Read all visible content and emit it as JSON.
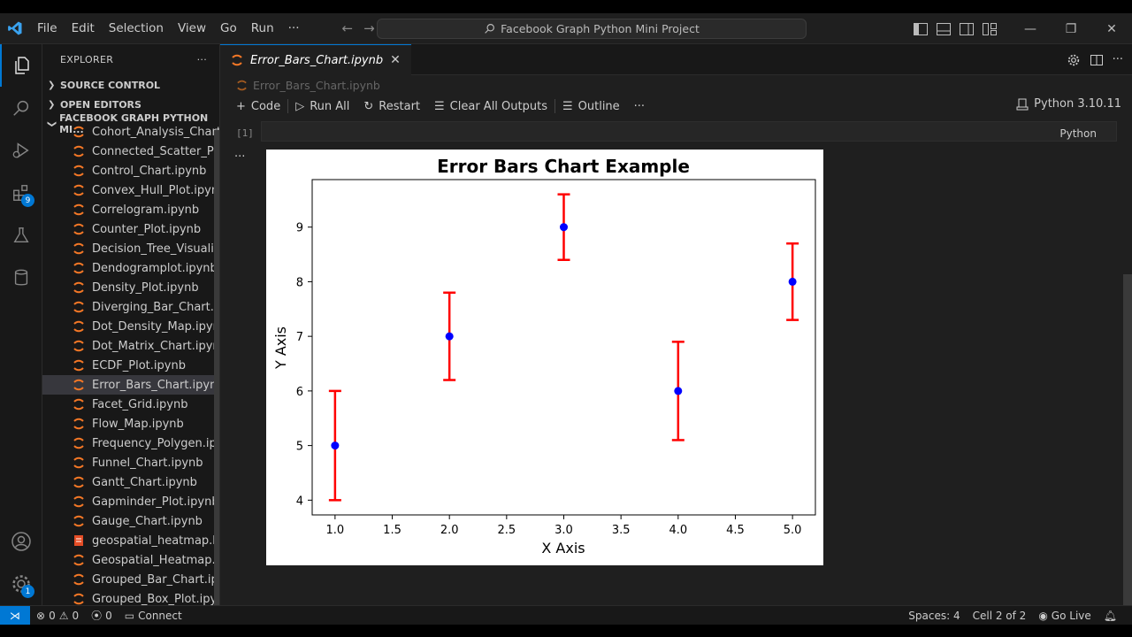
{
  "menu": [
    "File",
    "Edit",
    "Selection",
    "View",
    "Go",
    "Run"
  ],
  "menu_more": "···",
  "command_center": "Facebook Graph Python Mini Project",
  "activity_badges": {
    "extensions": "9",
    "accounts": "1"
  },
  "explorer": {
    "header": "EXPLORER",
    "more": "···",
    "sections": {
      "source_control": "SOURCE CONTROL",
      "open_editors": "OPEN EDITORS",
      "folder": "FACEBOOK GRAPH PYTHON MI..."
    },
    "files": [
      "Cohort_Analysis_Chart.i...",
      "Connected_Scatter_Plot...",
      "Control_Chart.ipynb",
      "Convex_Hull_Plot.ipynb",
      "Correlogram.ipynb",
      "Counter_Plot.ipynb",
      "Decision_Tree_Visualisa...",
      "Dendogramplot.ipynb",
      "Density_Plot.ipynb",
      "Diverging_Bar_Chart.ip...",
      "Dot_Density_Map.ipynb",
      "Dot_Matrix_Chart.ipynb",
      "ECDF_Plot.ipynb",
      "Error_Bars_Chart.ipynb",
      "Facet_Grid.ipynb",
      "Flow_Map.ipynb",
      "Frequency_Polygen.ipy...",
      "Funnel_Chart.ipynb",
      "Gantt_Chart.ipynb",
      "Gapminder_Plot.ipynb",
      "Gauge_Chart.ipynb",
      "geospatial_heatmap.html",
      "Geospatial_Heatmap.ip...",
      "Grouped_Bar_Chart.ipy...",
      "Grouped_Box_Plot.ipynb"
    ],
    "selected_index": 13
  },
  "editor": {
    "tab_label": "Error_Bars_Chart.ipynb",
    "breadcrumb": "Error_Bars_Chart.ipynb",
    "toolbar": {
      "code": "Code",
      "run_all": "Run All",
      "restart": "Restart",
      "clear": "Clear All Outputs",
      "outline": "Outline",
      "more": "···"
    },
    "kernel": "Python 3.10.11",
    "exec_count": "[1]",
    "cell_language": "Python",
    "output_menu": "···"
  },
  "chart_data": {
    "type": "scatter",
    "title": "Error Bars Chart Example",
    "xlabel": "X Axis",
    "ylabel": "Y Axis",
    "x": [
      1,
      2,
      3,
      4,
      5
    ],
    "y": [
      5,
      7,
      9,
      6,
      8
    ],
    "yerr": [
      1,
      0.8,
      0.6,
      0.9,
      0.7
    ],
    "xlim": [
      0.8,
      5.2
    ],
    "ylim": [
      3.73,
      9.87
    ],
    "xticks": [
      "1.0",
      "1.5",
      "2.0",
      "2.5",
      "3.0",
      "3.5",
      "4.0",
      "4.5",
      "5.0"
    ],
    "yticks": [
      "4",
      "5",
      "6",
      "7",
      "8",
      "9"
    ],
    "marker_color": "#0000ff",
    "errorbar_color": "#ff0000",
    "grid": false
  },
  "status": {
    "errors": "0",
    "warnings": "0",
    "ports": "0",
    "connect": "Connect",
    "spaces": "Spaces: 4",
    "cell": "Cell 2 of 2",
    "go_live": "Go Live"
  },
  "colors": {
    "accent": "#0078d4",
    "background": "#1f1f1f",
    "sidebar": "#181818"
  }
}
